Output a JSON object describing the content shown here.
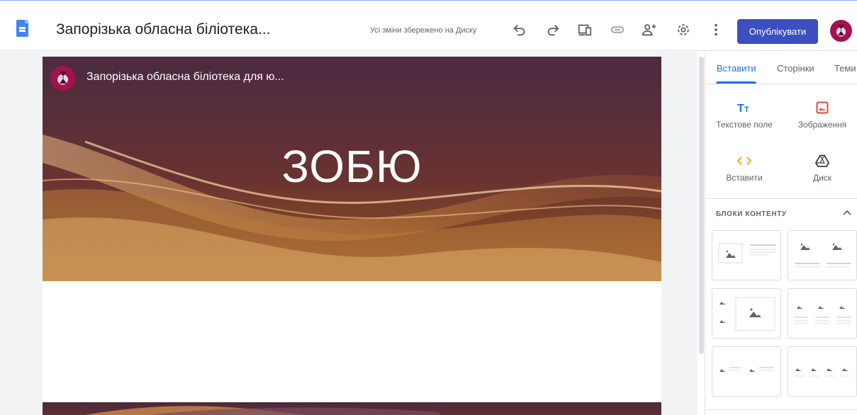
{
  "header": {
    "doc_title": "Запорізька обласна біліотека...",
    "saved_status": "Усі зміни збережено на Диску",
    "publish_label": "Опублікувати",
    "toolbar_icons": [
      "undo-icon",
      "redo-icon",
      "preview-device-icon",
      "link-icon",
      "share-add-person-icon",
      "settings-gear-icon",
      "more-vert-icon"
    ]
  },
  "page": {
    "site_name": "Запорізька обласна біліотека для ю...",
    "hero_title": "ЗОБЮ"
  },
  "panel": {
    "tabs": [
      {
        "label": "Вставити",
        "active": true
      },
      {
        "label": "Сторінки",
        "active": false
      },
      {
        "label": "Теми",
        "active": false
      }
    ],
    "insert_items": [
      {
        "label": "Текстове поле",
        "icon": "text-box-icon",
        "color": "#1a73e8"
      },
      {
        "label": "Зображення",
        "icon": "image-icon",
        "color": "#ea4335"
      },
      {
        "label": "Вставити",
        "icon": "embed-code-icon",
        "color": "#f9ab00"
      },
      {
        "label": "Диск",
        "icon": "drive-icon",
        "color": "#5f6368"
      }
    ],
    "blocks_heading": "БЛОКИ КОНТЕНТУ",
    "content_blocks": [
      "image-with-text-block",
      "two-images-with-text-block",
      "two-small-images-and-large-image-block",
      "three-images-with-text-block",
      "two-image-text-pairs-block",
      "four-images-with-text-block"
    ]
  },
  "colors": {
    "accent": "#1a73e8",
    "publish_button": "#3c4fc1",
    "canvas_background": "#f1f3f4"
  }
}
